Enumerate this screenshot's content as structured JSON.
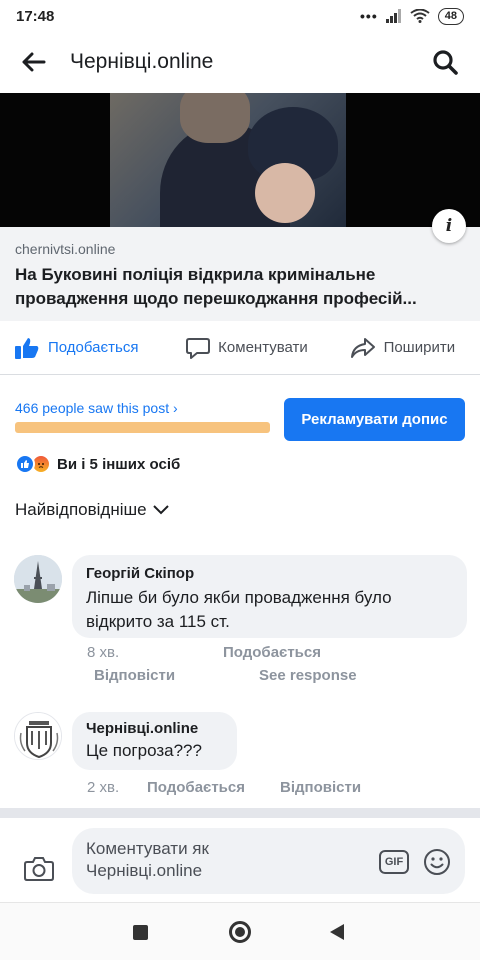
{
  "status_bar": {
    "time": "17:48",
    "battery": "48"
  },
  "header": {
    "title": "Чернівці.online"
  },
  "link_preview": {
    "domain": "chernivtsi.online",
    "headline": "На Буковині поліція відкрила кримінальне провадження щодо перешкоджання професій..."
  },
  "actions": {
    "like": "Подобається",
    "comment": "Коментувати",
    "share": "Поширити"
  },
  "insights": {
    "reach_text": "466 people saw this post",
    "promote_label": "Рекламувати допис"
  },
  "reactions": {
    "summary": "Ви і 5 інших осіб"
  },
  "sort": {
    "label": "Найвідповідніше"
  },
  "comments": [
    {
      "author": "Георгій Скіпор",
      "text": "Ліпше би було якби провадження було відкрито за 115 ст.",
      "time": "8 хв.",
      "like": "Подобається",
      "reply": "Відповісти",
      "see_response": "See response"
    },
    {
      "author": "Чернівці.online",
      "text": "Це погроза???",
      "time": "2 хв.",
      "like": "Подобається",
      "reply": "Відповісти"
    }
  ],
  "composer": {
    "placeholder": "Коментувати як Чернівці.online",
    "gif_label": "GIF"
  },
  "colors": {
    "brand_blue": "#1877f2",
    "progress": "#f7c37e",
    "bubble_bg": "#f0f2f5"
  }
}
